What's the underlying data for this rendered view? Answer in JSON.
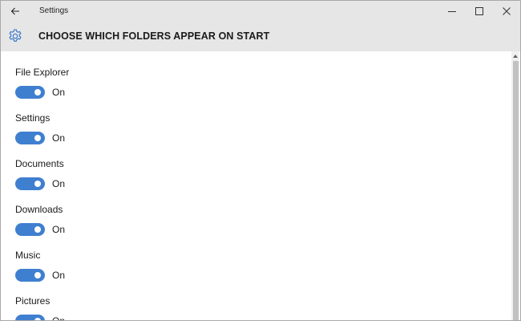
{
  "window": {
    "app_title": "Settings"
  },
  "header": {
    "title": "CHOOSE WHICH FOLDERS APPEAR ON START"
  },
  "settings": [
    {
      "label": "File Explorer",
      "state": "On"
    },
    {
      "label": "Settings",
      "state": "On"
    },
    {
      "label": "Documents",
      "state": "On"
    },
    {
      "label": "Downloads",
      "state": "On"
    },
    {
      "label": "Music",
      "state": "On"
    },
    {
      "label": "Pictures",
      "state": "On"
    }
  ],
  "colors": {
    "toggle_on": "#3f7fd0",
    "header_bg": "#e6e6e6",
    "gear_icon": "#3a78c9"
  },
  "icons": {
    "back": "back-arrow-icon",
    "minimize": "minimize-icon",
    "maximize": "maximize-icon",
    "close": "close-icon",
    "gear": "gear-icon"
  }
}
